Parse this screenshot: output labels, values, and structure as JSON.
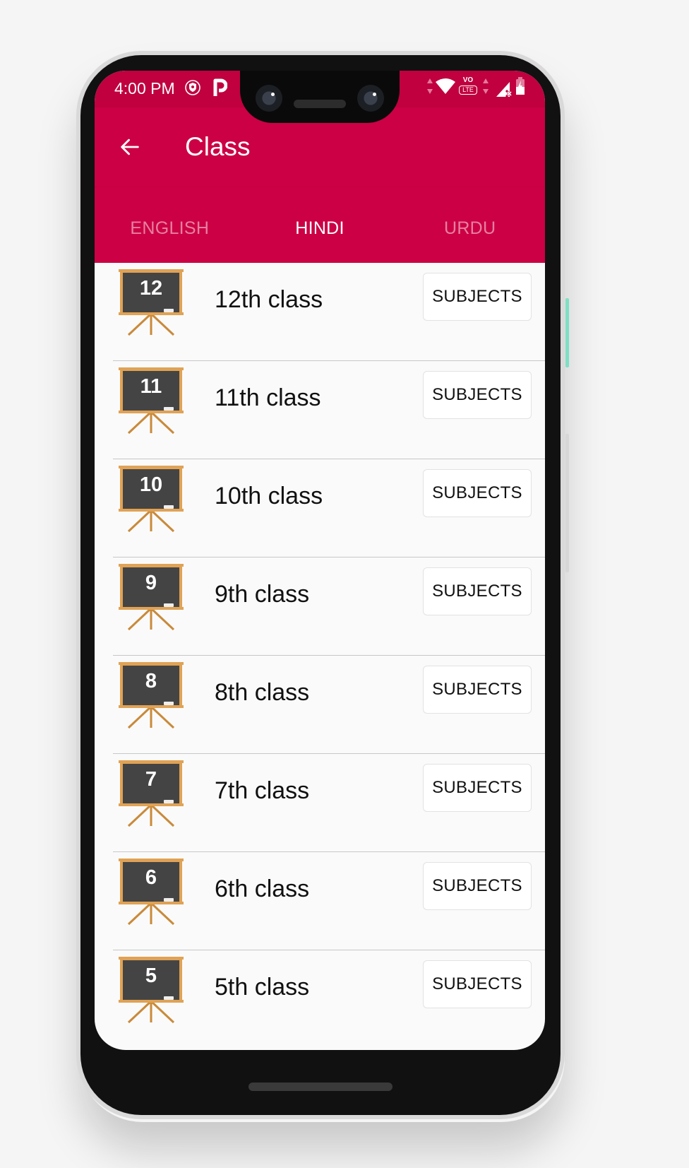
{
  "status_bar": {
    "time": "4:00 PM",
    "left_icons": [
      "vpn-shield-icon",
      "parking-p-icon"
    ],
    "right_icons": [
      "data-arrows-icon",
      "wifi-icon",
      "volte-icon",
      "data-arrows-icon",
      "signal-no-sim-icon",
      "battery-charging-icon"
    ],
    "volte_top": "VO",
    "volte_bottom": "LTE"
  },
  "app_bar": {
    "title": "Class",
    "back_icon": "arrow-left-icon",
    "background_color": "#cc0044"
  },
  "tabs": [
    {
      "label": "ENGLISH",
      "active": false
    },
    {
      "label": "HINDI",
      "active": true
    },
    {
      "label": "URDU",
      "active": false
    }
  ],
  "classes": [
    {
      "number": "12",
      "label": "12th class",
      "button": "SUBJECTS"
    },
    {
      "number": "11",
      "label": "11th class",
      "button": "SUBJECTS"
    },
    {
      "number": "10",
      "label": "10th class",
      "button": "SUBJECTS"
    },
    {
      "number": "9",
      "label": "9th class",
      "button": "SUBJECTS"
    },
    {
      "number": "8",
      "label": "8th class",
      "button": "SUBJECTS"
    },
    {
      "number": "7",
      "label": "7th class",
      "button": "SUBJECTS"
    },
    {
      "number": "6",
      "label": "6th class",
      "button": "SUBJECTS"
    },
    {
      "number": "5",
      "label": "5th class",
      "button": "SUBJECTS"
    }
  ]
}
